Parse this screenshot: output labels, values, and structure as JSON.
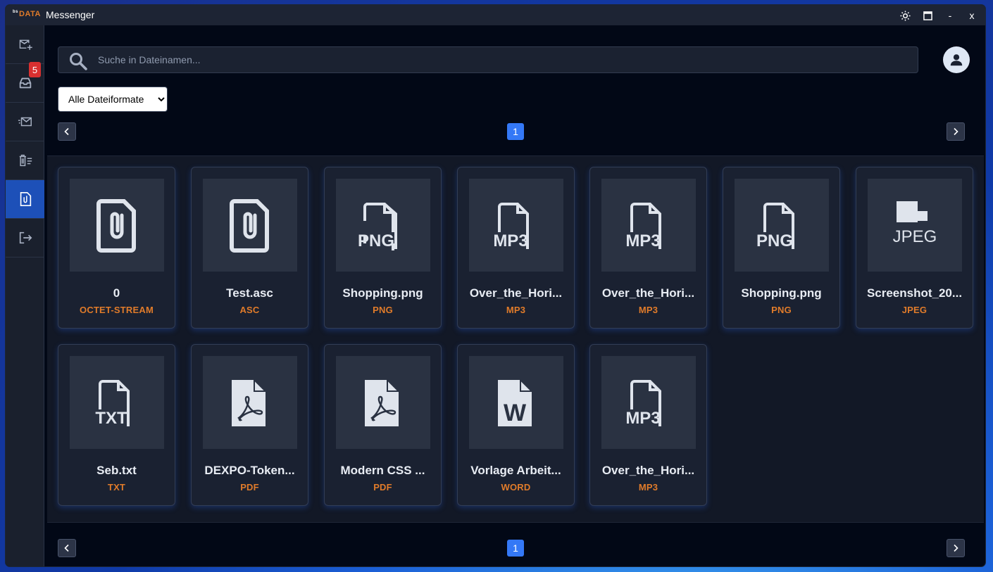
{
  "window": {
    "logo_prefix": "bs",
    "logo_text": "DATA",
    "title": "Messenger",
    "theme_icon": "sun-icon",
    "maximize_icon": "maximize-icon",
    "minimize_label": "-",
    "close_label": "x"
  },
  "sidebar": {
    "items": [
      {
        "name": "compose",
        "icon": "mail-plus-icon"
      },
      {
        "name": "inbox",
        "icon": "inbox-icon",
        "badge": "5"
      },
      {
        "name": "sent",
        "icon": "mail-sent-icon"
      },
      {
        "name": "trash",
        "icon": "trash-list-icon"
      },
      {
        "name": "files",
        "icon": "file-attachment-icon",
        "active": true
      },
      {
        "name": "logout",
        "icon": "logout-icon"
      }
    ]
  },
  "search": {
    "placeholder": "Suche in Dateinamen...",
    "value": ""
  },
  "filter": {
    "selected": "Alle Dateiformate"
  },
  "pagination": {
    "current_page": "1"
  },
  "files": [
    {
      "name": "0",
      "type": "OCTET-STREAM",
      "icon": "attachment-file-icon"
    },
    {
      "name": "Test.asc",
      "type": "ASC",
      "icon": "attachment-file-icon"
    },
    {
      "name": "Shopping.png",
      "type": "PNG",
      "icon": "png-file-icon",
      "icon_text": "PNG"
    },
    {
      "name": "Over_the_Hori...",
      "type": "MP3",
      "icon": "mp3-file-icon",
      "icon_text": "MP3"
    },
    {
      "name": "Over_the_Hori...",
      "type": "MP3",
      "icon": "mp3-file-icon",
      "icon_text": "MP3"
    },
    {
      "name": "Shopping.png",
      "type": "PNG",
      "icon": "png-file-icon",
      "icon_text": "PNG"
    },
    {
      "name": "Screenshot_20...",
      "type": "JPEG",
      "icon": "jpeg-file-icon",
      "icon_text": "JPEG"
    },
    {
      "name": "Seb.txt",
      "type": "TXT",
      "icon": "txt-file-icon",
      "icon_text": "TXT"
    },
    {
      "name": "DEXPO-Token...",
      "type": "PDF",
      "icon": "pdf-file-icon"
    },
    {
      "name": "Modern CSS ...",
      "type": "PDF",
      "icon": "pdf-file-icon"
    },
    {
      "name": "Vorlage Arbeit...",
      "type": "WORD",
      "icon": "word-file-icon",
      "icon_text": "W"
    },
    {
      "name": "Over_the_Hori...",
      "type": "MP3",
      "icon": "mp3-file-icon",
      "icon_text": "MP3"
    }
  ],
  "colors": {
    "accent": "#3478f6",
    "sidebar_active": "#1d50b8",
    "file_type": "#e07b2a",
    "badge": "#d93030"
  }
}
